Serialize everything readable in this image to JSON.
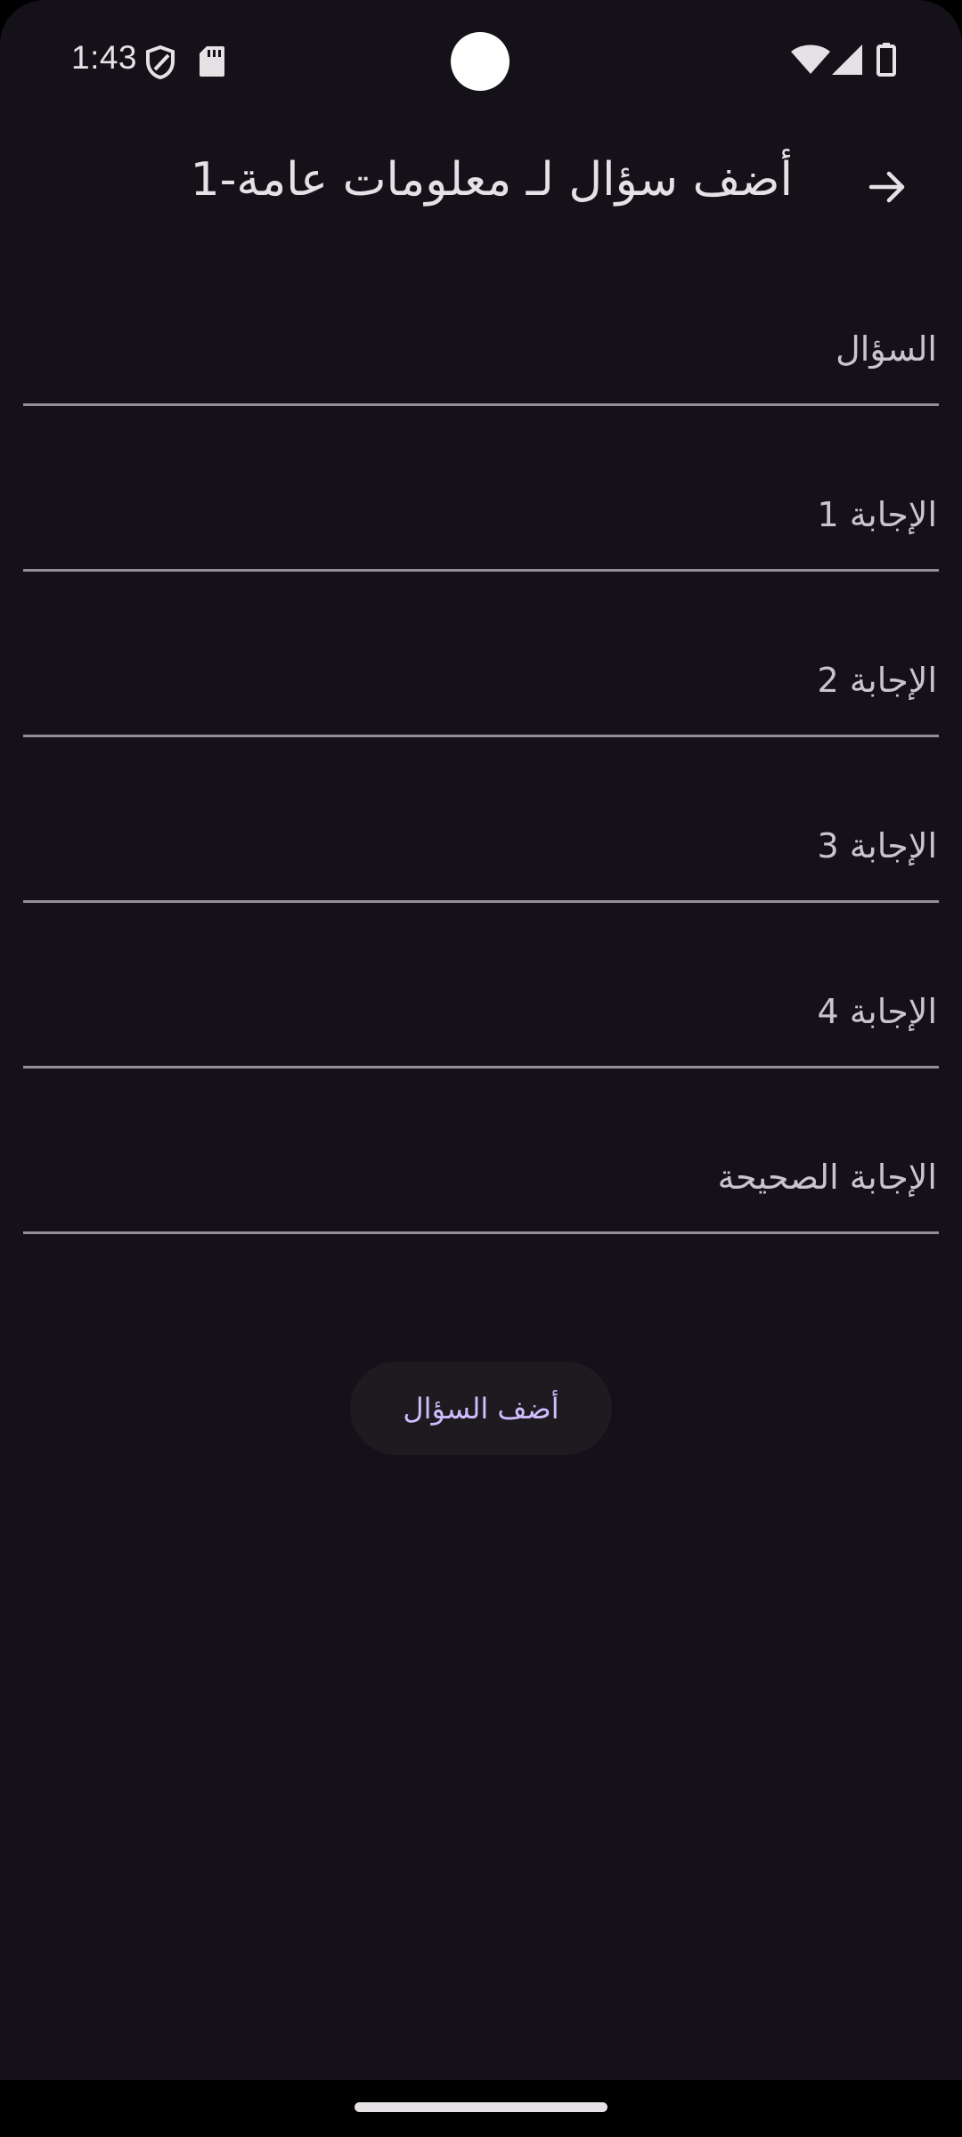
{
  "status_bar": {
    "time": "1:43",
    "icons": [
      "shield-icon",
      "sd-card-icon",
      "wifi-icon",
      "cellular-signal-icon",
      "battery-icon"
    ]
  },
  "app_bar": {
    "title": "أضف سؤال لـ معلومات عامة-1",
    "back_icon": "arrow-forward-icon"
  },
  "form": {
    "question_placeholder": "السؤال",
    "answer1_placeholder": "الإجابة 1",
    "answer2_placeholder": "الإجابة 2",
    "answer3_placeholder": "الإجابة 3",
    "answer4_placeholder": "الإجابة 4",
    "correct_answer_placeholder": "الإجابة الصحيحة"
  },
  "actions": {
    "add_question_label": "أضف السؤال"
  },
  "colors": {
    "background": "#141218",
    "text": "#E6E1E5",
    "hint": "#CAC4D0",
    "divider": "#938F99",
    "button_bg": "#1D1B20",
    "accent": "#D0BCFF"
  }
}
